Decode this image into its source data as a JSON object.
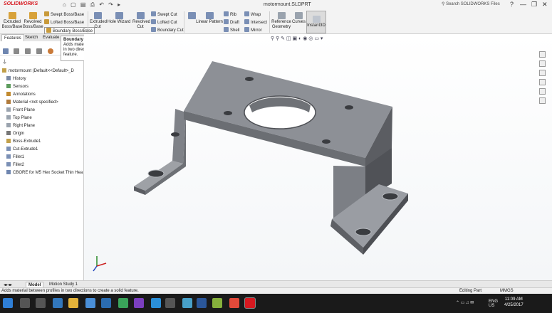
{
  "app": {
    "logo": "SOLIDWORKS",
    "doc_title": "motormount.SLDPRT",
    "search_placeholder": "Search SOLIDWORKS Files",
    "window_controls": [
      "?",
      "—",
      "❐",
      "✕"
    ]
  },
  "ribbon": {
    "big_buttons": [
      {
        "label": "Extruded\nBoss/Base",
        "icon": "extrude-boss-icon"
      },
      {
        "label": "Revolved\nBoss/Base",
        "icon": "revolve-boss-icon"
      },
      {
        "label": "Extruded\nCut",
        "icon": "extrude-cut-icon"
      },
      {
        "label": "Hole Wizard",
        "icon": "hole-wizard-icon"
      },
      {
        "label": "Revolved\nCut",
        "icon": "revolve-cut-icon"
      },
      {
        "label": "Fillet",
        "icon": "fillet-icon"
      },
      {
        "label": "Linear Pattern",
        "icon": "pattern-icon"
      },
      {
        "label": "Reference\nGeometry",
        "icon": "ref-geometry-icon"
      },
      {
        "label": "Curves",
        "icon": "curves-icon"
      },
      {
        "label": "Instant3D",
        "icon": "instant3d-icon"
      }
    ],
    "small_cmds": [
      "Swept Boss/Base",
      "Lofted Boss/Base",
      "Boundary Boss/Base",
      "Swept Cut",
      "Lofted Cut",
      "Boundary Cut",
      "Rib",
      "Draft",
      "Shell",
      "Wrap",
      "Intersect",
      "Mirror"
    ]
  },
  "tabs": [
    "Features",
    "Sketch",
    "Evaluate"
  ],
  "tooltip": {
    "title": "Boundary Boss/Base",
    "body": "Adds material between profiles in two directions to create a solid feature."
  },
  "tree": {
    "filter_icon": "filter-icon",
    "root": "motormount (Default<<Default>_D",
    "items": [
      {
        "label": "History",
        "icon": "history-icon"
      },
      {
        "label": "Sensors",
        "icon": "sensor-icon"
      },
      {
        "label": "Annotations",
        "icon": "annotation-icon"
      },
      {
        "label": "Material <not specified>",
        "icon": "material-icon"
      },
      {
        "label": "Front Plane",
        "icon": "plane-icon"
      },
      {
        "label": "Top Plane",
        "icon": "plane-icon"
      },
      {
        "label": "Right Plane",
        "icon": "plane-icon"
      },
      {
        "label": "Origin",
        "icon": "origin-icon"
      },
      {
        "label": "Boss-Extrude1",
        "icon": "extrude-icon"
      },
      {
        "label": "Cut-Extrude1",
        "icon": "cut-icon"
      },
      {
        "label": "Fillet1",
        "icon": "fillet-icon"
      },
      {
        "label": "Fillet2",
        "icon": "fillet-icon"
      },
      {
        "label": "CBORE for M5 Hex Socket Thin Hea",
        "icon": "hole-icon"
      }
    ]
  },
  "bottom_tabs": [
    "Model",
    "Motion Study 1"
  ],
  "status": {
    "left": "Adds material between profiles in two directions to create a solid feature.",
    "editing": "Editing Part",
    "units": "MMGS"
  },
  "taskbar": {
    "time": "11:09 AM",
    "date": "4/25/2017",
    "lang": "ENG\nUS",
    "icons": [
      "windows-icon",
      "search-icon",
      "task-view-icon",
      "edge-icon",
      "explorer-icon",
      "store-icon",
      "mail-icon",
      "app-icon-1",
      "visual-studio-icon",
      "app-icon-2",
      "settings-icon",
      "app-icon-3",
      "word-icon",
      "app-icon-4",
      "chrome-icon",
      "solidworks-icon"
    ]
  },
  "colors": {
    "model_face": "#8e9197",
    "model_dark": "#5a5c61",
    "accent_red": "#d71920"
  }
}
